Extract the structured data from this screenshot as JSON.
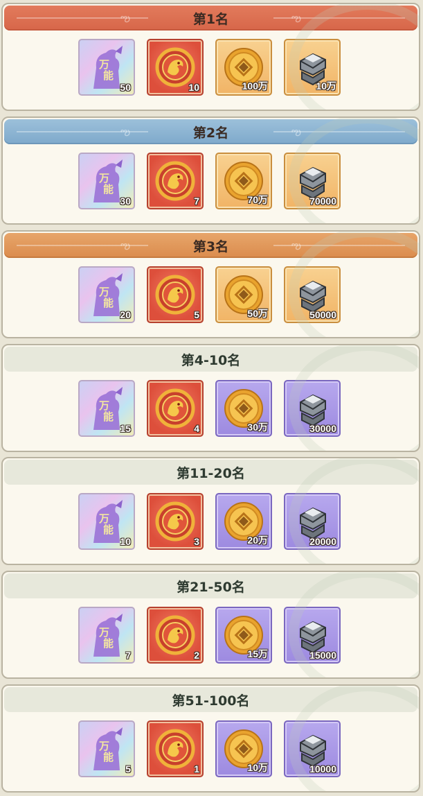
{
  "rewards": [
    {
      "title": "第1名",
      "header_style": "red",
      "items": [
        {
          "icon": "universal-shard-icon",
          "bg": "rainbow",
          "qty": "50"
        },
        {
          "icon": "dragon-emblem-icon",
          "bg": "red",
          "qty": "10"
        },
        {
          "icon": "copper-coin-icon",
          "bg": "orange",
          "qty": "100万"
        },
        {
          "icon": "iron-ore-icon",
          "bg": "orange",
          "qty": "10万"
        }
      ]
    },
    {
      "title": "第2名",
      "header_style": "blue",
      "items": [
        {
          "icon": "universal-shard-icon",
          "bg": "rainbow",
          "qty": "30"
        },
        {
          "icon": "dragon-emblem-icon",
          "bg": "red",
          "qty": "7"
        },
        {
          "icon": "copper-coin-icon",
          "bg": "orange",
          "qty": "70万"
        },
        {
          "icon": "iron-ore-icon",
          "bg": "orange",
          "qty": "70000"
        }
      ]
    },
    {
      "title": "第3名",
      "header_style": "orange",
      "items": [
        {
          "icon": "universal-shard-icon",
          "bg": "rainbow",
          "qty": "20"
        },
        {
          "icon": "dragon-emblem-icon",
          "bg": "red",
          "qty": "5"
        },
        {
          "icon": "copper-coin-icon",
          "bg": "orange",
          "qty": "50万"
        },
        {
          "icon": "iron-ore-icon",
          "bg": "orange",
          "qty": "50000"
        }
      ]
    },
    {
      "title": "第4-10名",
      "header_style": "plain",
      "items": [
        {
          "icon": "universal-shard-icon",
          "bg": "rainbow",
          "qty": "15"
        },
        {
          "icon": "dragon-emblem-icon",
          "bg": "red",
          "qty": "4"
        },
        {
          "icon": "copper-coin-icon",
          "bg": "purple",
          "qty": "30万"
        },
        {
          "icon": "iron-ore-icon",
          "bg": "purple",
          "qty": "30000"
        }
      ]
    },
    {
      "title": "第11-20名",
      "header_style": "plain",
      "items": [
        {
          "icon": "universal-shard-icon",
          "bg": "rainbow",
          "qty": "10"
        },
        {
          "icon": "dragon-emblem-icon",
          "bg": "red",
          "qty": "3"
        },
        {
          "icon": "copper-coin-icon",
          "bg": "purple",
          "qty": "20万"
        },
        {
          "icon": "iron-ore-icon",
          "bg": "purple",
          "qty": "20000"
        }
      ]
    },
    {
      "title": "第21-50名",
      "header_style": "plain",
      "items": [
        {
          "icon": "universal-shard-icon",
          "bg": "rainbow",
          "qty": "7"
        },
        {
          "icon": "dragon-emblem-icon",
          "bg": "red",
          "qty": "2"
        },
        {
          "icon": "copper-coin-icon",
          "bg": "purple",
          "qty": "15万"
        },
        {
          "icon": "iron-ore-icon",
          "bg": "purple",
          "qty": "15000"
        }
      ]
    },
    {
      "title": "第51-100名",
      "header_style": "plain",
      "items": [
        {
          "icon": "universal-shard-icon",
          "bg": "rainbow",
          "qty": "5"
        },
        {
          "icon": "dragon-emblem-icon",
          "bg": "red",
          "qty": "1"
        },
        {
          "icon": "copper-coin-icon",
          "bg": "purple",
          "qty": "10万"
        },
        {
          "icon": "iron-ore-icon",
          "bg": "purple",
          "qty": "10000"
        }
      ]
    }
  ],
  "shard_icon_text": [
    "万",
    "能"
  ],
  "colors": {
    "header_red": "#dd6e50",
    "header_blue": "#8ab3d2",
    "header_orange": "#e19a5a",
    "header_plain": "#e7e8db",
    "card_bg": "#fbf8ee"
  }
}
